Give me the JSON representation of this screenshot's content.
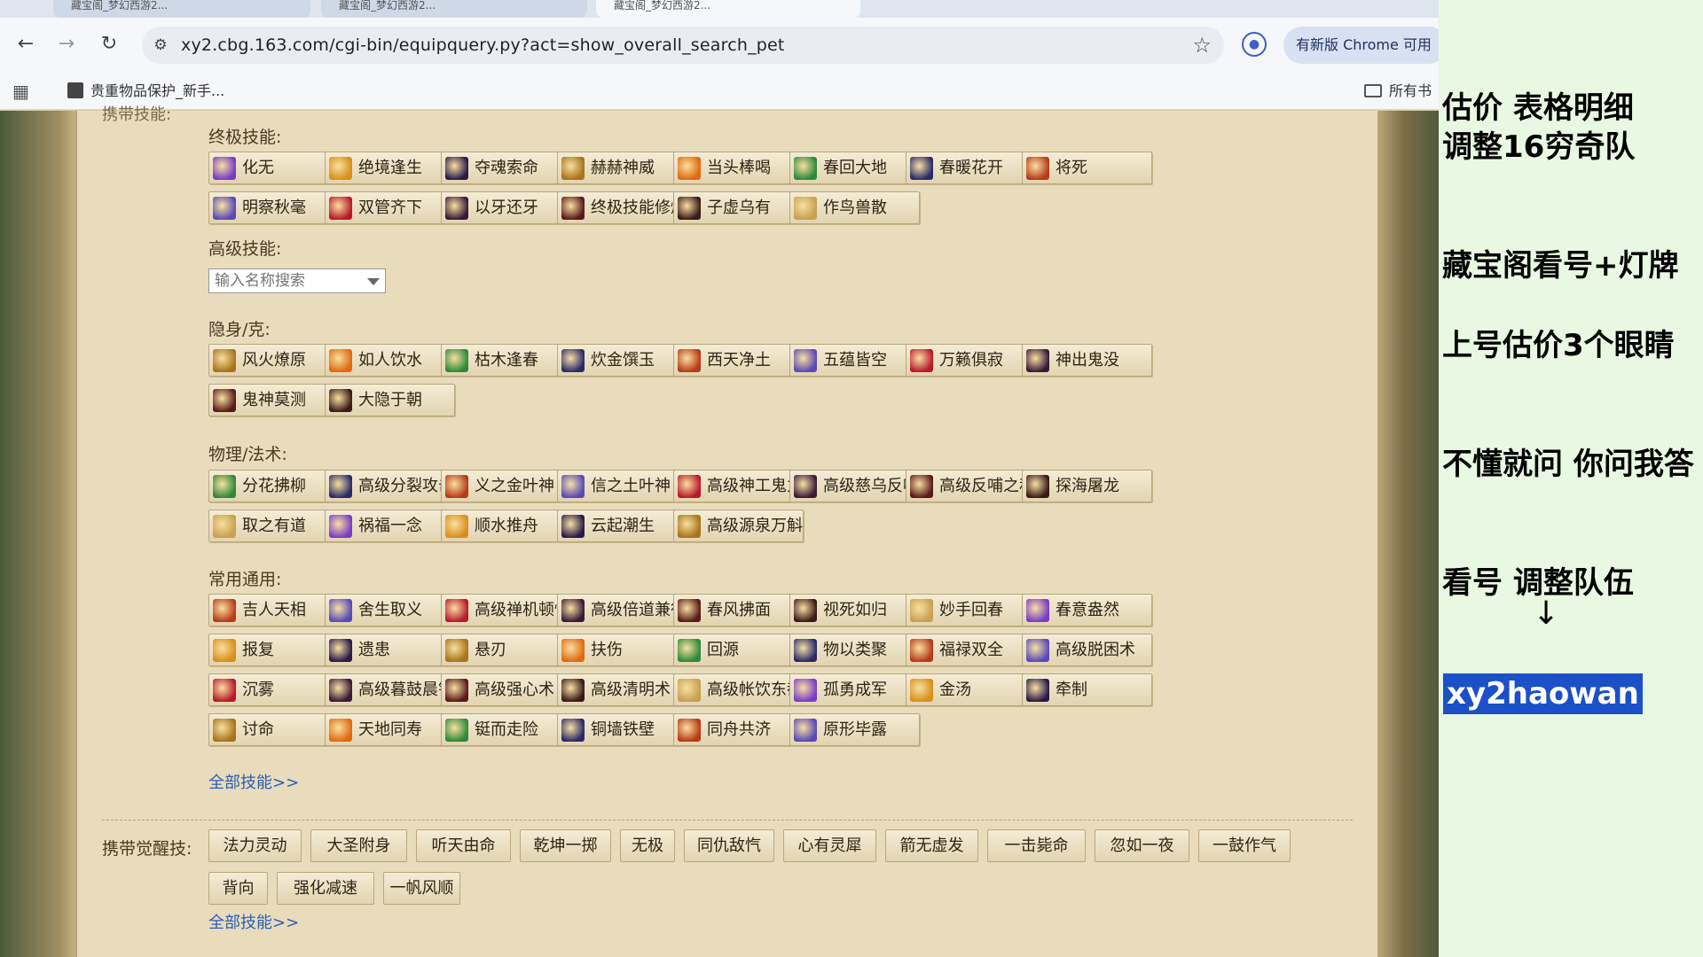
{
  "tabs": [
    {
      "label": "藏宝阁_梦幻西游2..."
    },
    {
      "label": "藏宝阁_梦幻西游2..."
    },
    {
      "label": "藏宝阁_梦幻西游2..."
    }
  ],
  "toolbar": {
    "url": "xy2.cbg.163.com/cgi-bin/equipquery.py?act=show_overall_search_pet",
    "update_button": "有新版 Chrome 可用"
  },
  "bookmarks": {
    "item1": "贵重物品保护_新手...",
    "all": "所有书"
  },
  "page": {
    "cut_label": "携带技能:",
    "sections": {
      "ultimate": {
        "title": "终极技能:",
        "skills": [
          "化无",
          "绝境逢生",
          "夺魂索命",
          "赫赫神威",
          "当头棒喝",
          "春回大地",
          "春暖花开",
          "将死",
          "明察秋毫",
          "双管齐下",
          "以牙还牙",
          "终极技能修炼",
          "子虚乌有",
          "作鸟兽散"
        ]
      },
      "advanced": {
        "title": "高级技能:",
        "search_placeholder": "输入名称搜索"
      },
      "stealth": {
        "title": "隐身/克:",
        "skills": [
          "风火燎原",
          "如人饮水",
          "枯木逢春",
          "炊金馔玉",
          "西天净土",
          "五蕴皆空",
          "万籁俱寂",
          "神出鬼没",
          "鬼神莫测",
          "大隐于朝"
        ]
      },
      "physical": {
        "title": "物理/法术:",
        "skills": [
          "分花拂柳",
          "高级分裂攻击",
          "义之金叶神",
          "信之土叶神",
          "高级神工鬼力",
          "高级慈乌反哺",
          "高级反哺之私",
          "探海屠龙",
          "取之有道",
          "祸福一念",
          "顺水推舟",
          "云起潮生",
          "高级源泉万斛"
        ]
      },
      "common": {
        "title": "常用通用:",
        "skills": [
          "吉人天相",
          "舍生取义",
          "高级禅机顿悟",
          "高级倍道兼行",
          "春风拂面",
          "视死如归",
          "妙手回春",
          "春意盎然",
          "报复",
          "遗患",
          "悬刃",
          "扶伤",
          "回源",
          "物以类聚",
          "福禄双全",
          "高级脱困术",
          "沉雾",
          "高级暮鼓晨钟",
          "高级强心术",
          "高级清明术",
          "高级帐饮东都",
          "孤勇成军",
          "金汤",
          "牵制",
          "讨命",
          "天地同寿",
          "铤而走险",
          "铜墙铁壁",
          "同舟共济",
          "原形毕露"
        ]
      }
    },
    "all_skills_link": "全部技能>>",
    "awaken": {
      "label": "携带觉醒技:",
      "skills": [
        "法力灵动",
        "大圣附身",
        "听天由命",
        "乾坤一掷",
        "无极",
        "同仇敌忾",
        "心有灵犀",
        "箭无虚发",
        "一击毙命",
        "忽如一夜",
        "一鼓作气",
        "背向",
        "强化减速",
        "一帆风顺"
      ]
    }
  },
  "overlay": {
    "line1": "估价  表格明细",
    "line2": "调整16穷奇队",
    "line3": "藏宝阁看号+灯牌",
    "line4": "上号估价3个眼睛",
    "line5": "不懂就问 你问我答",
    "line6": " 看号 调整队伍",
    "arrow": "↓",
    "brand": "xy2haowan"
  },
  "icons": {
    "back": "arrow-left-icon",
    "forward": "arrow-right-icon",
    "reload": "reload-icon",
    "site": "site-info-icon",
    "star": "star-icon",
    "profile": "profile-icon",
    "apps": "apps-grid-icon",
    "folder": "folder-icon"
  },
  "colors": {
    "page_bg": "#d8c59a",
    "panel_bg": "#e8dcbc",
    "link": "#2a5db8",
    "overlay_bg": "#e9f8e2",
    "brand_bg": "#1b50c8"
  }
}
